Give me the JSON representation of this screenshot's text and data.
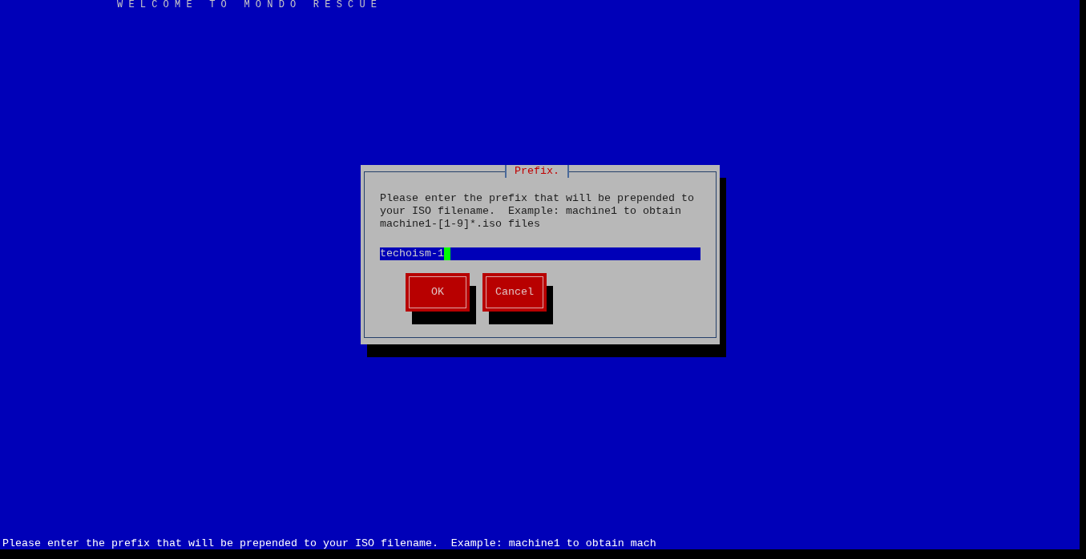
{
  "screen_title": "W E L C O M E   T O   M O N D O   R E S C U E",
  "dialog": {
    "title": "Prefix.",
    "message": "Please enter the prefix that will be prepended to your ISO filename.  Example: machine1 to obtain machine1-[1-9]*.iso files",
    "input": {
      "value": "techoism-1"
    },
    "buttons": [
      {
        "label": "OK"
      },
      {
        "label": "Cancel"
      }
    ]
  },
  "status_bar": "Please enter the prefix that will be prepended to your ISO filename.  Example: machine1 to obtain mach"
}
